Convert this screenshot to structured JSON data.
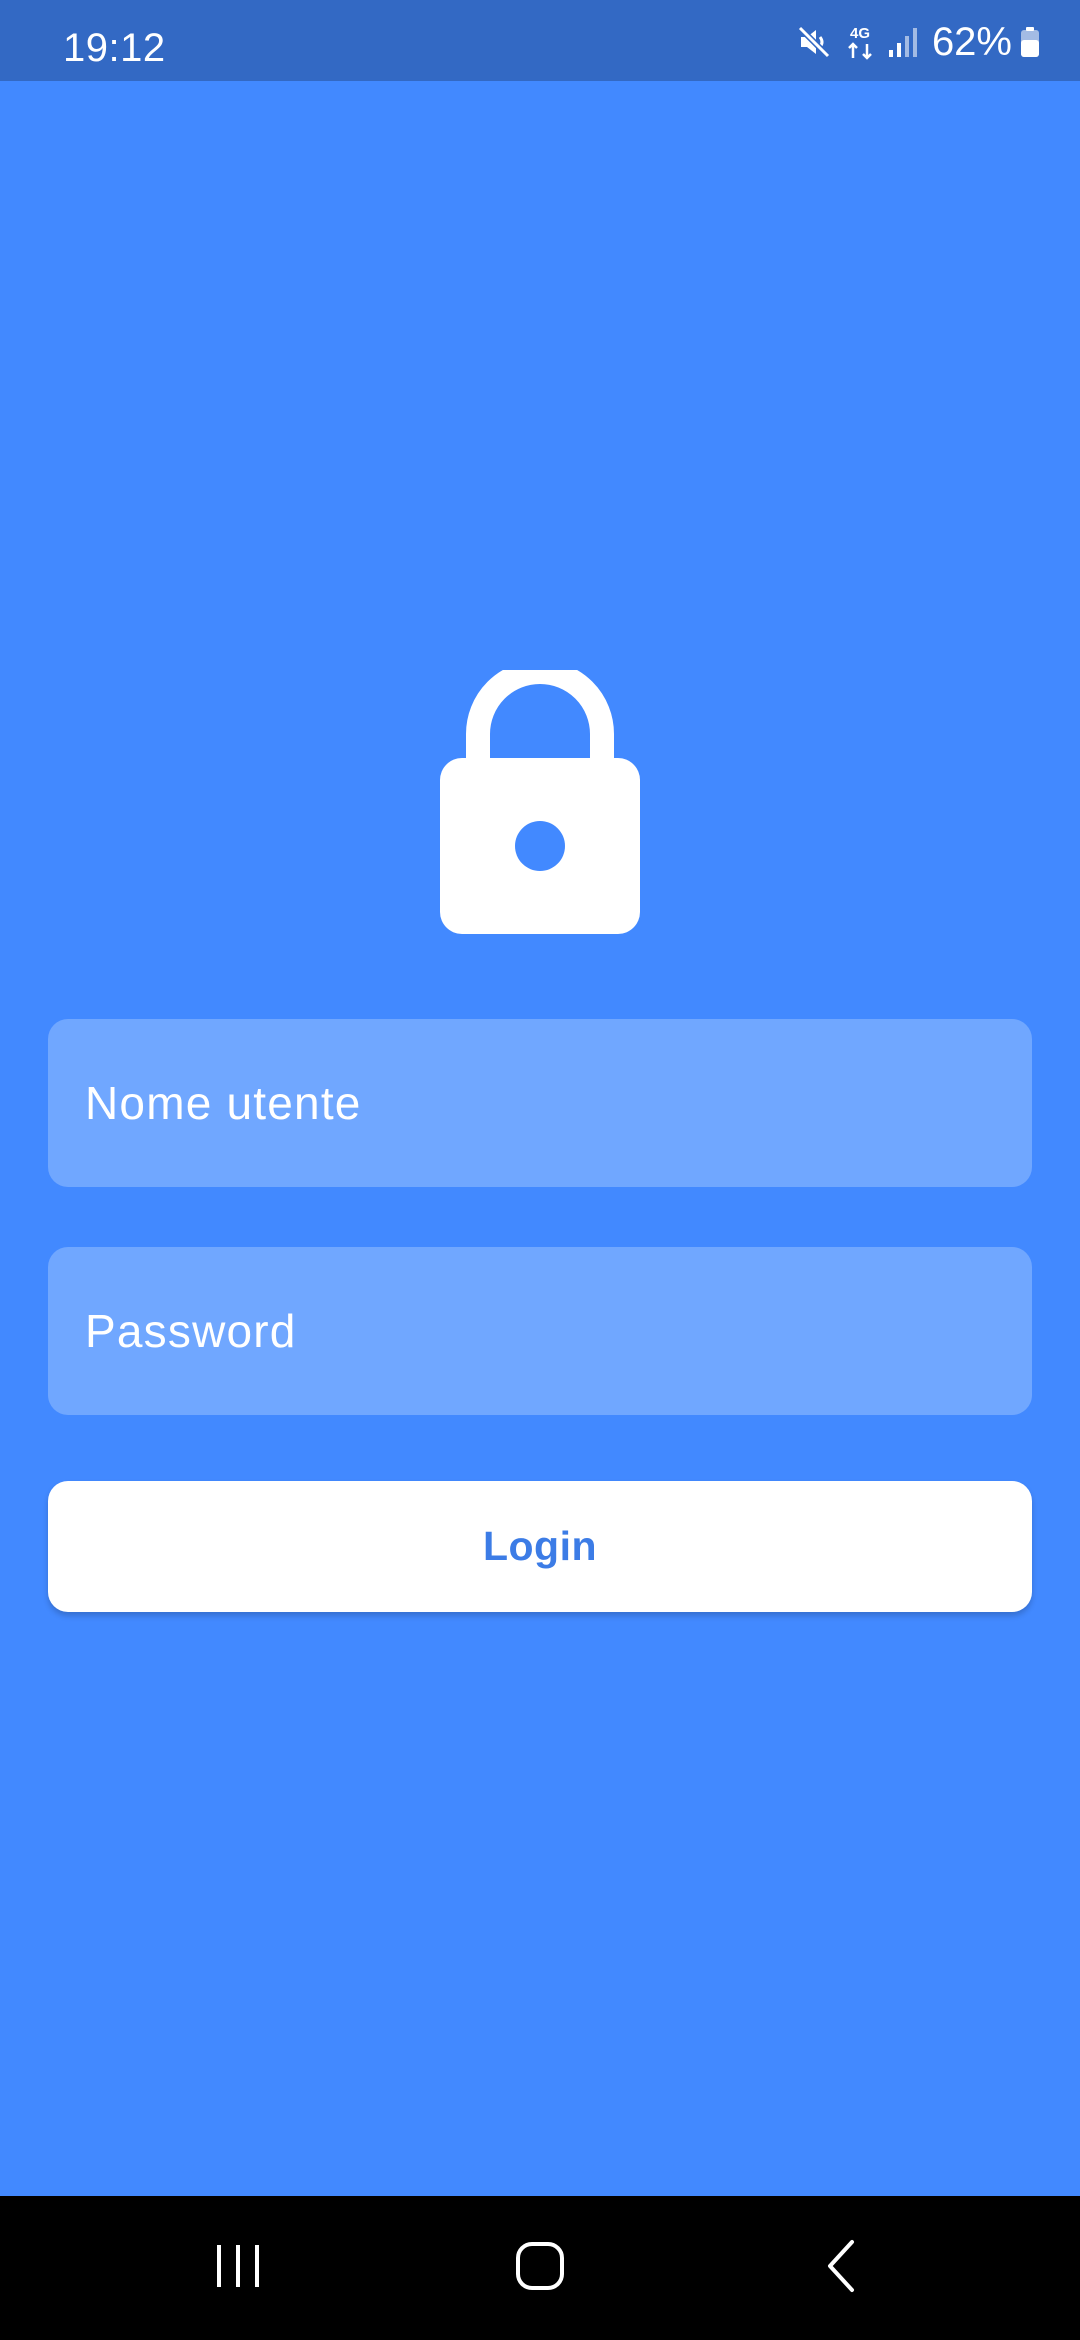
{
  "status_bar": {
    "time": "19:12",
    "battery_percent": "62%",
    "network": "4G",
    "icons": [
      "mute-icon",
      "4g-data-icon",
      "signal-icon",
      "battery-icon"
    ]
  },
  "login": {
    "username_placeholder": "Nome utente",
    "password_placeholder": "Password",
    "login_label": "Login"
  },
  "nav_bar": {
    "buttons": [
      "recents",
      "home",
      "back"
    ]
  },
  "colors": {
    "background": "#4289FF",
    "status_bar": "#3369C4",
    "field_background": "#70A7FF",
    "button_background": "#FFFFFF",
    "button_text": "#3C7CE6",
    "nav_bar": "#000000"
  }
}
